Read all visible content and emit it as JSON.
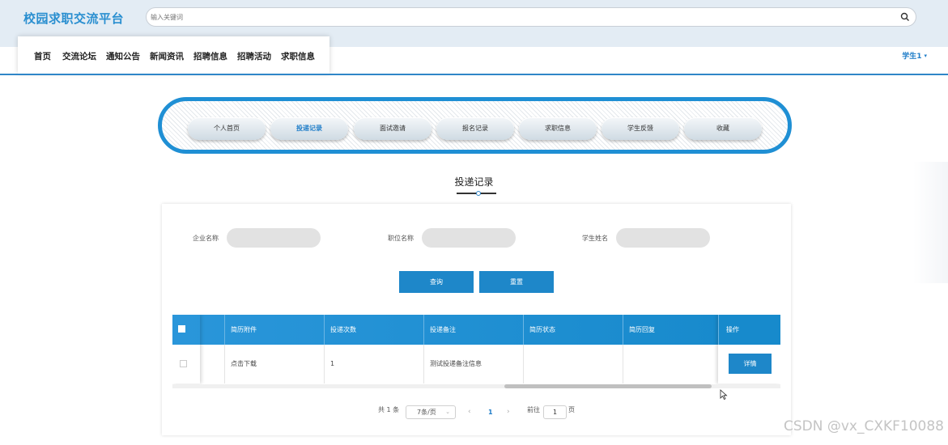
{
  "header": {
    "logo": "校园求职交流平台",
    "search_placeholder": "输入关键词",
    "search_icon": "magnifier-icon",
    "nav": [
      "首页",
      "交流论坛",
      "通知公告",
      "新闻资讯",
      "招聘信息",
      "招聘活动",
      "求职信息"
    ],
    "user_label": "学生1"
  },
  "tabs": [
    "个人首页",
    "投递记录",
    "面试邀请",
    "报名记录",
    "求职信息",
    "学生反馈",
    "收藏"
  ],
  "active_tab": "投递记录",
  "section_title": "投递记录",
  "filters": {
    "company_label": "企业名称",
    "position_label": "职位名称",
    "student_label": "学生姓名",
    "company_value": "",
    "position_value": "",
    "student_value": ""
  },
  "buttons": {
    "search": "查询",
    "reset": "重置"
  },
  "table": {
    "headers": [
      "简历附件",
      "投递次数",
      "投递备注",
      "简历状态",
      "简历回复",
      "操作"
    ],
    "rows": [
      {
        "attachment": "点击下载",
        "count": "1",
        "remark": "测试投递备注信息",
        "status": "",
        "reply": "",
        "action": "详情"
      }
    ]
  },
  "pagination": {
    "total": "共 1 条",
    "page_size": "7条/页",
    "current_page": "1",
    "goto_label": "前往",
    "goto_value": "1",
    "page_suffix": "页"
  },
  "watermark": "CSDN @vx_CXKF10088",
  "colors": {
    "primary": "#1e87c9",
    "accent": "#2a8fd0",
    "header_bg": "#e3ecf4"
  }
}
